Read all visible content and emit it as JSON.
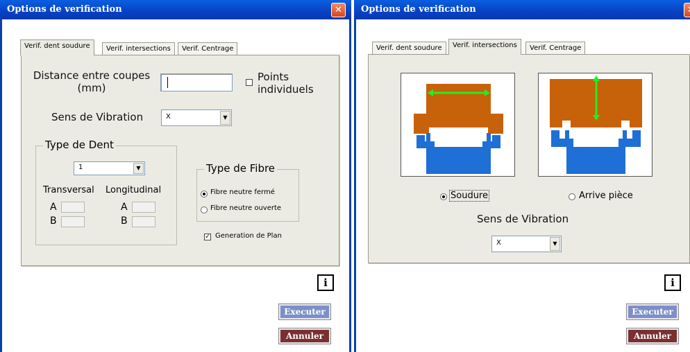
{
  "window1": {
    "title": "Options de verification",
    "close_glyph": "✕",
    "tabs": [
      "Verif. dent soudure",
      "Verif. intersections",
      "Verif. Centrage"
    ],
    "active_tab": 0,
    "distance_label_1": "Distance entre coupes",
    "distance_label_2": "(mm)",
    "distance_value": "",
    "points_label_1": "Points",
    "points_label_2": "individuels",
    "points_checked": false,
    "sens_label": "Sens de Vibration",
    "sens_value": "X",
    "type_dent": {
      "legend": "Type de Dent",
      "value": "1",
      "transversal": "Transversal",
      "longitudinal": "Longitudinal",
      "a": "A",
      "b": "B"
    },
    "type_fibre": {
      "legend": "Type de Fibre",
      "options": [
        "Fibre neutre fermé",
        "Fibre neutre ouverte"
      ],
      "selected": 0
    },
    "generation_label": "Generation de Plan",
    "generation_checked": true,
    "info_label": "i",
    "execute_label": "Executer",
    "cancel_label": "Annuler"
  },
  "window2": {
    "title": "Options de verification",
    "close_glyph": "✕",
    "tabs": [
      "Verif. dent soudure",
      "Verif. intersections",
      "Verif. Centrage"
    ],
    "active_tab": 1,
    "radio_options": [
      "Soudure",
      "Arrive pièce"
    ],
    "selected": 0,
    "sens_label": "Sens de Vibration",
    "sens_value": "X",
    "info_label": "i",
    "execute_label": "Executer",
    "cancel_label": "Annuler"
  },
  "colors": {
    "title_bar": "#0842c4",
    "part_top": "#c8620a",
    "part_bottom": "#1e6fd6",
    "arrow": "#22ee22",
    "execute_button": "#7d8fc9",
    "cancel_button": "#7a3030"
  },
  "icons": [
    "close-icon",
    "info-icon",
    "dropdown-arrow-icon"
  ]
}
